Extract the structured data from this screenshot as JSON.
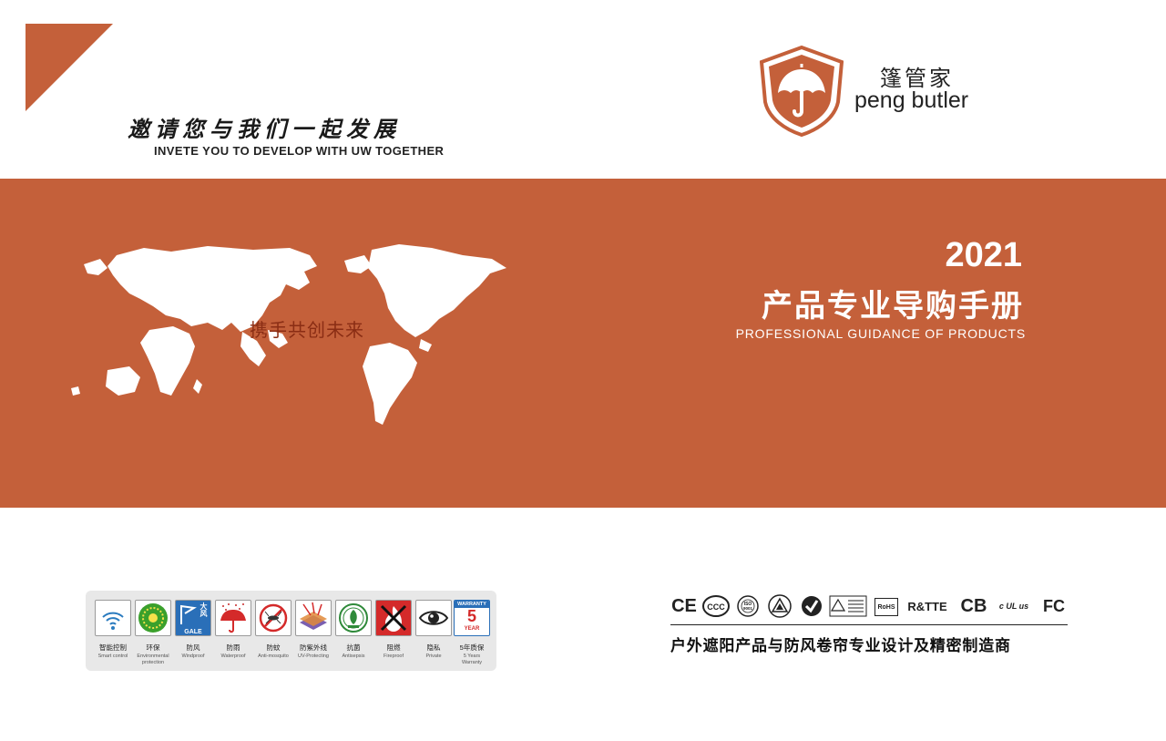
{
  "header": {
    "slogan_cn": "邀请您与我们一起发展",
    "slogan_en": "INVETE YOU TO DEVELOP WITH UW TOGETHER"
  },
  "brand": {
    "name_cn": "篷管家",
    "name_en": "peng butler",
    "logo_icon": "shield-umbrella-icon"
  },
  "banner": {
    "map_caption": "携手共创未来",
    "year": "2021",
    "title_cn": "产品专业导购手册",
    "title_en": "PROFESSIONAL  GUIDANCE OF PRODUCTS"
  },
  "features": [
    {
      "icon": "smart-control-icon",
      "label": "智能控制",
      "sub": "Smart control"
    },
    {
      "icon": "environmental-icon",
      "label": "环保",
      "sub": "Environmental protection"
    },
    {
      "icon": "windproof-icon",
      "label": "防风",
      "sub": "Windproof",
      "badge_top": "大风",
      "badge_bottom": "GALE"
    },
    {
      "icon": "waterproof-icon",
      "label": "防雨",
      "sub": "Waterproof"
    },
    {
      "icon": "anti-mosquito-icon",
      "label": "防蚊",
      "sub": "Anti-mosquito"
    },
    {
      "icon": "uv-protecting-icon",
      "label": "防紫外线",
      "sub": "UV-Protecting"
    },
    {
      "icon": "antisepsis-icon",
      "label": "抗菌",
      "sub": "Antisepsis"
    },
    {
      "icon": "fireproof-icon",
      "label": "阻燃",
      "sub": "Fireproof"
    },
    {
      "icon": "private-icon",
      "label": "隐私",
      "sub": "Private"
    },
    {
      "icon": "warranty-icon",
      "label": "5年质保",
      "sub": "5 Years Warranty",
      "badge_top": "WARRANTY",
      "badge_num": "5",
      "badge_bottom": "YEAR"
    }
  ],
  "certifications": {
    "ce": "CE",
    "rtte": "R&TTE",
    "cb": "CB",
    "fc": "FC",
    "rohs": "RoHS",
    "ul": "c UL us",
    "iso": "ISO 9001"
  },
  "footer": {
    "tagline_cn": "户外遮阳产品与防风卷帘专业设计及精密制造商"
  },
  "colors": {
    "brand_orange": "#c4603a",
    "dark_text": "#222222"
  }
}
